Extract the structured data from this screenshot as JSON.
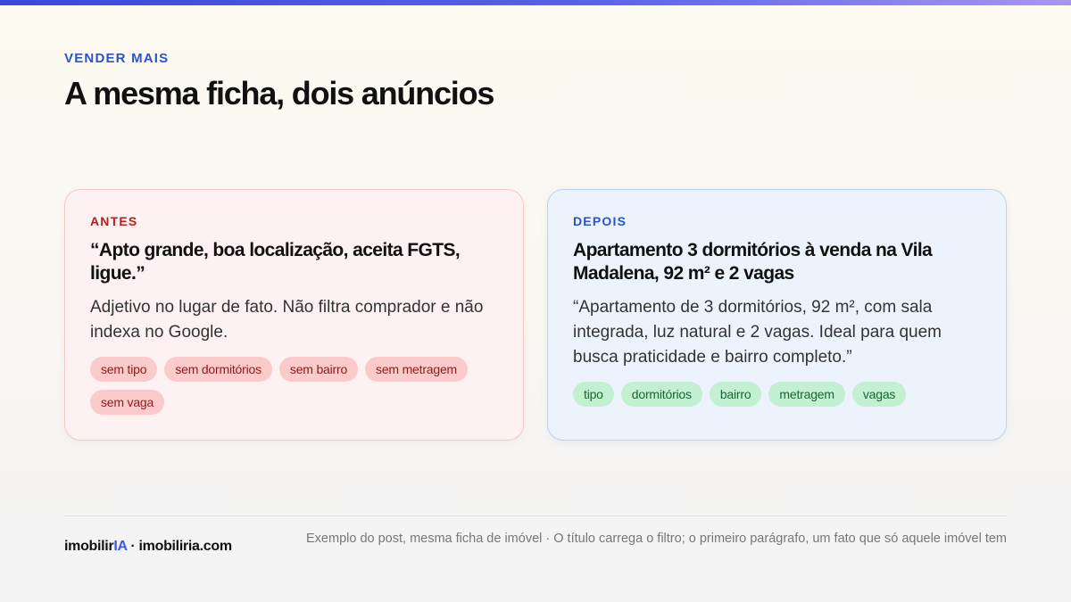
{
  "header": {
    "eyebrow": "VENDER MAIS",
    "title": "A mesma ficha, dois anúncios"
  },
  "cards": {
    "before": {
      "tag": "ANTES",
      "headline": "“Apto grande, boa localização, aceita FGTS, ligue.”",
      "body": "Adjetivo no lugar de fato. Não filtra comprador e não indexa no Google.",
      "chips": [
        "sem tipo",
        "sem dormitórios",
        "sem bairro",
        "sem metragem",
        "sem vaga"
      ]
    },
    "after": {
      "tag": "DEPOIS",
      "headline": "Apartamento 3 dormitórios à venda na Vila Madalena, 92 m² e 2 vagas",
      "body": "“Apartamento de 3 dormitórios, 92 m², com sala integrada, luz natural e 2 vagas. Ideal para quem busca praticidade e bairro completo.”",
      "chips": [
        "tipo",
        "dormitórios",
        "bairro",
        "metragem",
        "vagas"
      ]
    }
  },
  "footer": {
    "brand_prefix": "imobilir",
    "brand_accent": "IA",
    "brand_suffix": " · imobiliria.com",
    "note": "Exemplo do post, mesma ficha de imóvel · O título carrega o filtro; o primeiro parágrafo, um fato que só aquele imóvel tem"
  },
  "colors": {
    "accent_blue": "#2b54c9",
    "before_red": "#b42121",
    "after_green": "#1b6632"
  }
}
